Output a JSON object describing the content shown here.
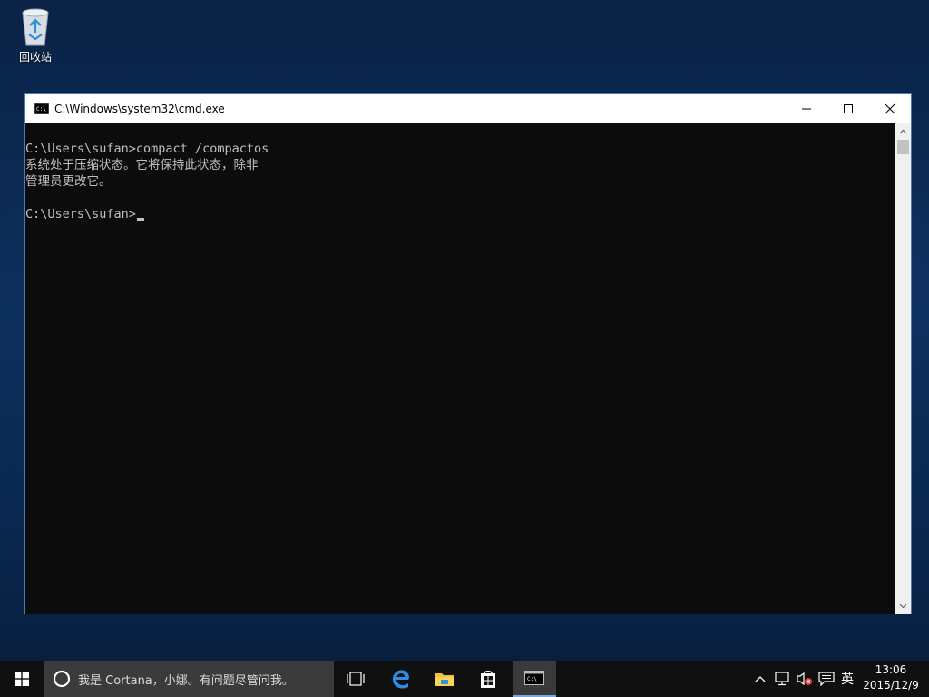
{
  "desktop": {
    "recycle_bin_label": "回收站"
  },
  "window": {
    "title": "C:\\Windows\\system32\\cmd.exe",
    "buttons": {
      "minimize": "minimize-icon",
      "maximize": "maximize-icon",
      "close": "close-icon"
    }
  },
  "console": {
    "lines": [
      "C:\\Users\\sufan>compact /compactos",
      "系统处于压缩状态。它将保持此状态，除非",
      "管理员更改它。",
      "",
      "C:\\Users\\sufan>"
    ]
  },
  "taskbar": {
    "search_placeholder": "我是 Cortana，小娜。有问题尽管问我。",
    "apps": [
      "task-view-icon",
      "edge-icon",
      "file-explorer-icon",
      "store-icon",
      "cmd-icon"
    ],
    "tray": {
      "ime": "英",
      "time": "13:06",
      "date": "2015/12/9"
    }
  },
  "colors": {
    "console_bg": "#0c0c0c",
    "console_text": "#c0c0c0",
    "taskbar_bg": "#101010",
    "search_bg": "#3b3b3b",
    "window_border": "#4a79b7"
  }
}
